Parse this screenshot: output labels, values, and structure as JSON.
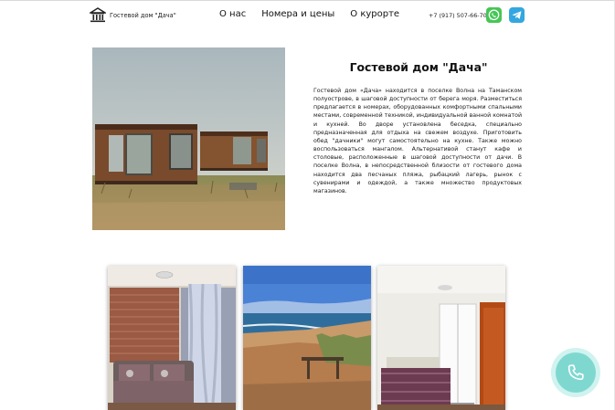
{
  "header": {
    "logo_text": "Гостевой дом \"Дача\"",
    "nav": [
      {
        "label": "О нас"
      },
      {
        "label": "Номера и цены"
      },
      {
        "label": "О курорте"
      }
    ],
    "phone": "+7 (917) 507-66-70",
    "whatsapp_icon": "whatsapp-icon",
    "telegram_icon": "telegram-icon"
  },
  "hero": {
    "title": "Гостевой дом \"Дача\"",
    "description": "Гостевой дом «Дача» находится в поселке Волна на Таманском полуострове, в шаговой доступности от берега моря. Разместиться предлагается в номерах, оборудованных комфортными спальными местами, современной техникой, индивидуальной ванной комнатой и кухней. Во дворе установлена беседка, специально предназначенная для отдыха на свежем воздухе. Приготовить обед \"дачники\" могут самостоятельно на кухне. Также можно воспользоваться мангалом. Альтернативой станут кафе и столовые, расположенные в шаговой доступности от дачи. В поселке Волна, в непосредственной близости от гостевого дома находится два песчаных пляжа, рыбацкий лагерь, рынок с сувенирами и одеждой, а также множество продуктовых магазинов."
  },
  "call_button_icon": "phone-icon",
  "colors": {
    "whatsapp": "#45c655",
    "telegram": "#34a7e0",
    "call_button": "#7fd8d0"
  }
}
